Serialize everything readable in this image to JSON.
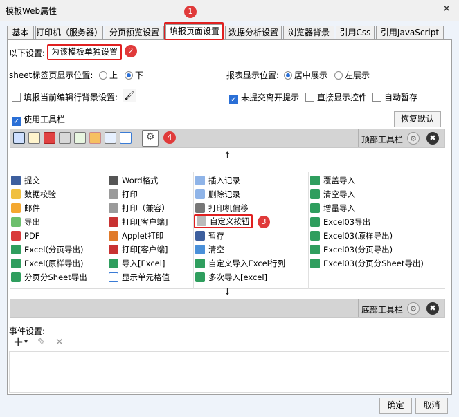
{
  "window": {
    "title": "模板Web属性",
    "close_glyph": "✕"
  },
  "tabs": [
    "基本",
    "打印机（服务器）",
    "分页预览设置",
    "填报页面设置",
    "数据分析设置",
    "浏览器背景",
    "引用Css",
    "引用JavaScript"
  ],
  "annotations": [
    "1",
    "2",
    "3",
    "4"
  ],
  "settings": {
    "scope_label": "以下设置:",
    "scope_value": "为该模板单独设置",
    "sheet_tab_pos_label": "sheet标签页显示位置:",
    "sheet_tab_options": [
      "上",
      "下"
    ],
    "sheet_tab_selected": "下",
    "report_pos_label": "报表显示位置:",
    "report_pos_options": [
      "居中展示",
      "左展示"
    ],
    "report_pos_selected": "居中展示",
    "fill_bg_label": "填报当前编辑行背景设置:",
    "unsubmitted_label": "未提交离开提示",
    "direct_ctrl_label": "直接显示控件",
    "autosave_label": "自动暂存",
    "use_toolbar_label": "使用工具栏",
    "restore_label": "恢复默认"
  },
  "toolbars": {
    "top_label": "顶部工具栏",
    "bottom_label": "底部工具栏",
    "up_arrow": "↑",
    "down_arrow": "↓",
    "gear_glyph": "⚙",
    "remove_glyph": "✖"
  },
  "buttons": {
    "col1": [
      "提交",
      "数据校验",
      "邮件",
      "导出",
      "PDF",
      "Excel(分页导出)",
      "Excel(原样导出)",
      "分页分Sheet导出"
    ],
    "col2": [
      "Word格式",
      "打印",
      "打印（兼容）",
      "打印[客户端]",
      "Applet打印",
      "打印[客户端]",
      "导入[Excel]",
      "显示单元格值"
    ],
    "col3": [
      "插入记录",
      "删除记录",
      "打印机偏移",
      "自定义按钮",
      "暂存",
      "清空",
      "自定义导入Excel行列",
      "多次导入[excel]"
    ],
    "col4": [
      "覆盖导入",
      "清空导入",
      "增量导入",
      "Excel03导出",
      "Excel03(原样导出)",
      "Excel03(分页导出)",
      "Excel03(分页分Sheet导出)"
    ]
  },
  "events": {
    "label": "事件设置:",
    "add_glyph": "+",
    "dropdown_glyph": "▾",
    "edit_glyph": "✎",
    "delete_glyph": "✕"
  },
  "footer": {
    "ok": "确定",
    "cancel": "取消"
  }
}
